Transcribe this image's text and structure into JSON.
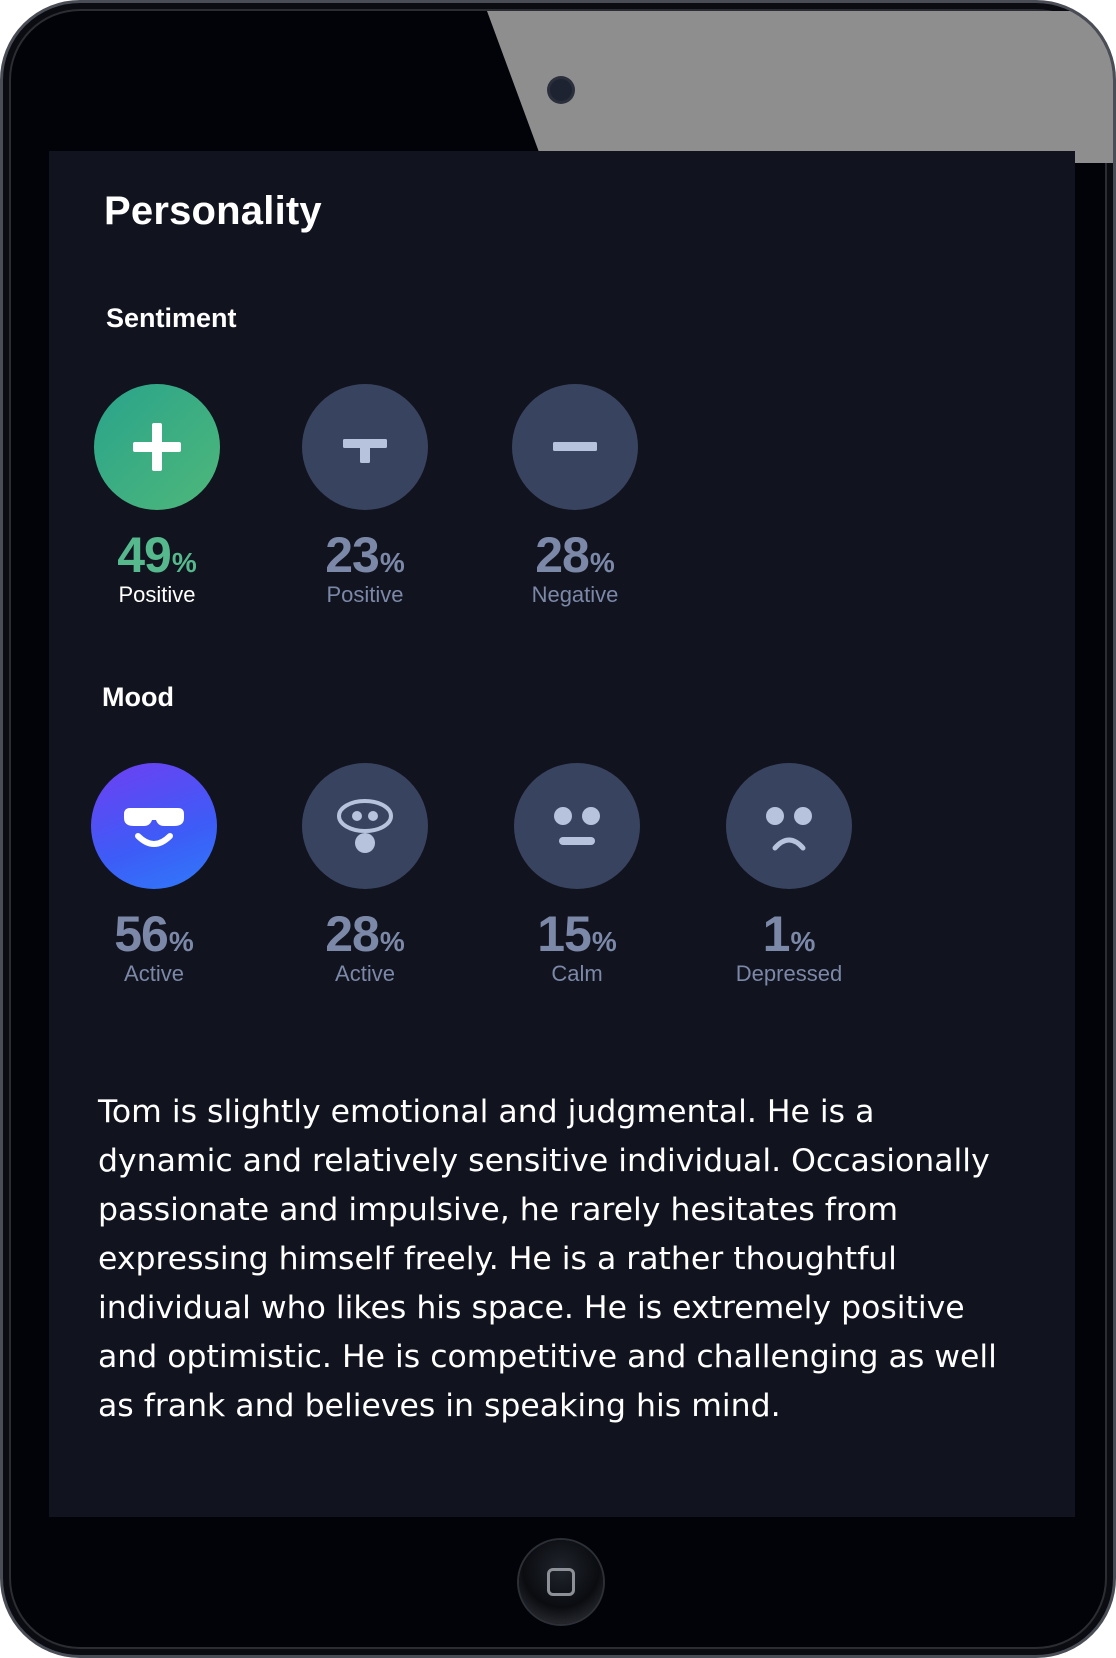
{
  "page": {
    "title": "Personality"
  },
  "sentiment": {
    "title": "Sentiment",
    "items": [
      {
        "value": "49",
        "unit": "%",
        "label": "Positive",
        "icon": "plus-icon",
        "color": "#4fb87a"
      },
      {
        "value": "23",
        "unit": "%",
        "label": "Positive",
        "icon": "neutral-t-icon",
        "color": "#38435f"
      },
      {
        "value": "28",
        "unit": "%",
        "label": "Negative",
        "icon": "minus-icon",
        "color": "#38435f"
      }
    ]
  },
  "mood": {
    "title": "Mood",
    "items": [
      {
        "value": "56",
        "unit": "%",
        "label": "Active",
        "icon": "sunglasses-face-icon",
        "color": "#4b50f5"
      },
      {
        "value": "28",
        "unit": "%",
        "label": "Active",
        "icon": "surprised-face-icon",
        "color": "#38435f"
      },
      {
        "value": "15",
        "unit": "%",
        "label": "Calm",
        "icon": "neutral-face-icon",
        "color": "#38435f"
      },
      {
        "value": "1",
        "unit": "%",
        "label": "Depressed",
        "icon": "sad-face-icon",
        "color": "#38435f"
      }
    ]
  },
  "description": "Tom is slightly emotional and judgmental. He is a dynamic and relatively sensitive individual. Occasionally passionate and impulsive, he rarely hesitates from expressing himself freely. He is a rather thoughtful individual who likes his space. He is extremely positive and optimistic. He is competitive and challenging as well as frank and believes in speaking his mind."
}
